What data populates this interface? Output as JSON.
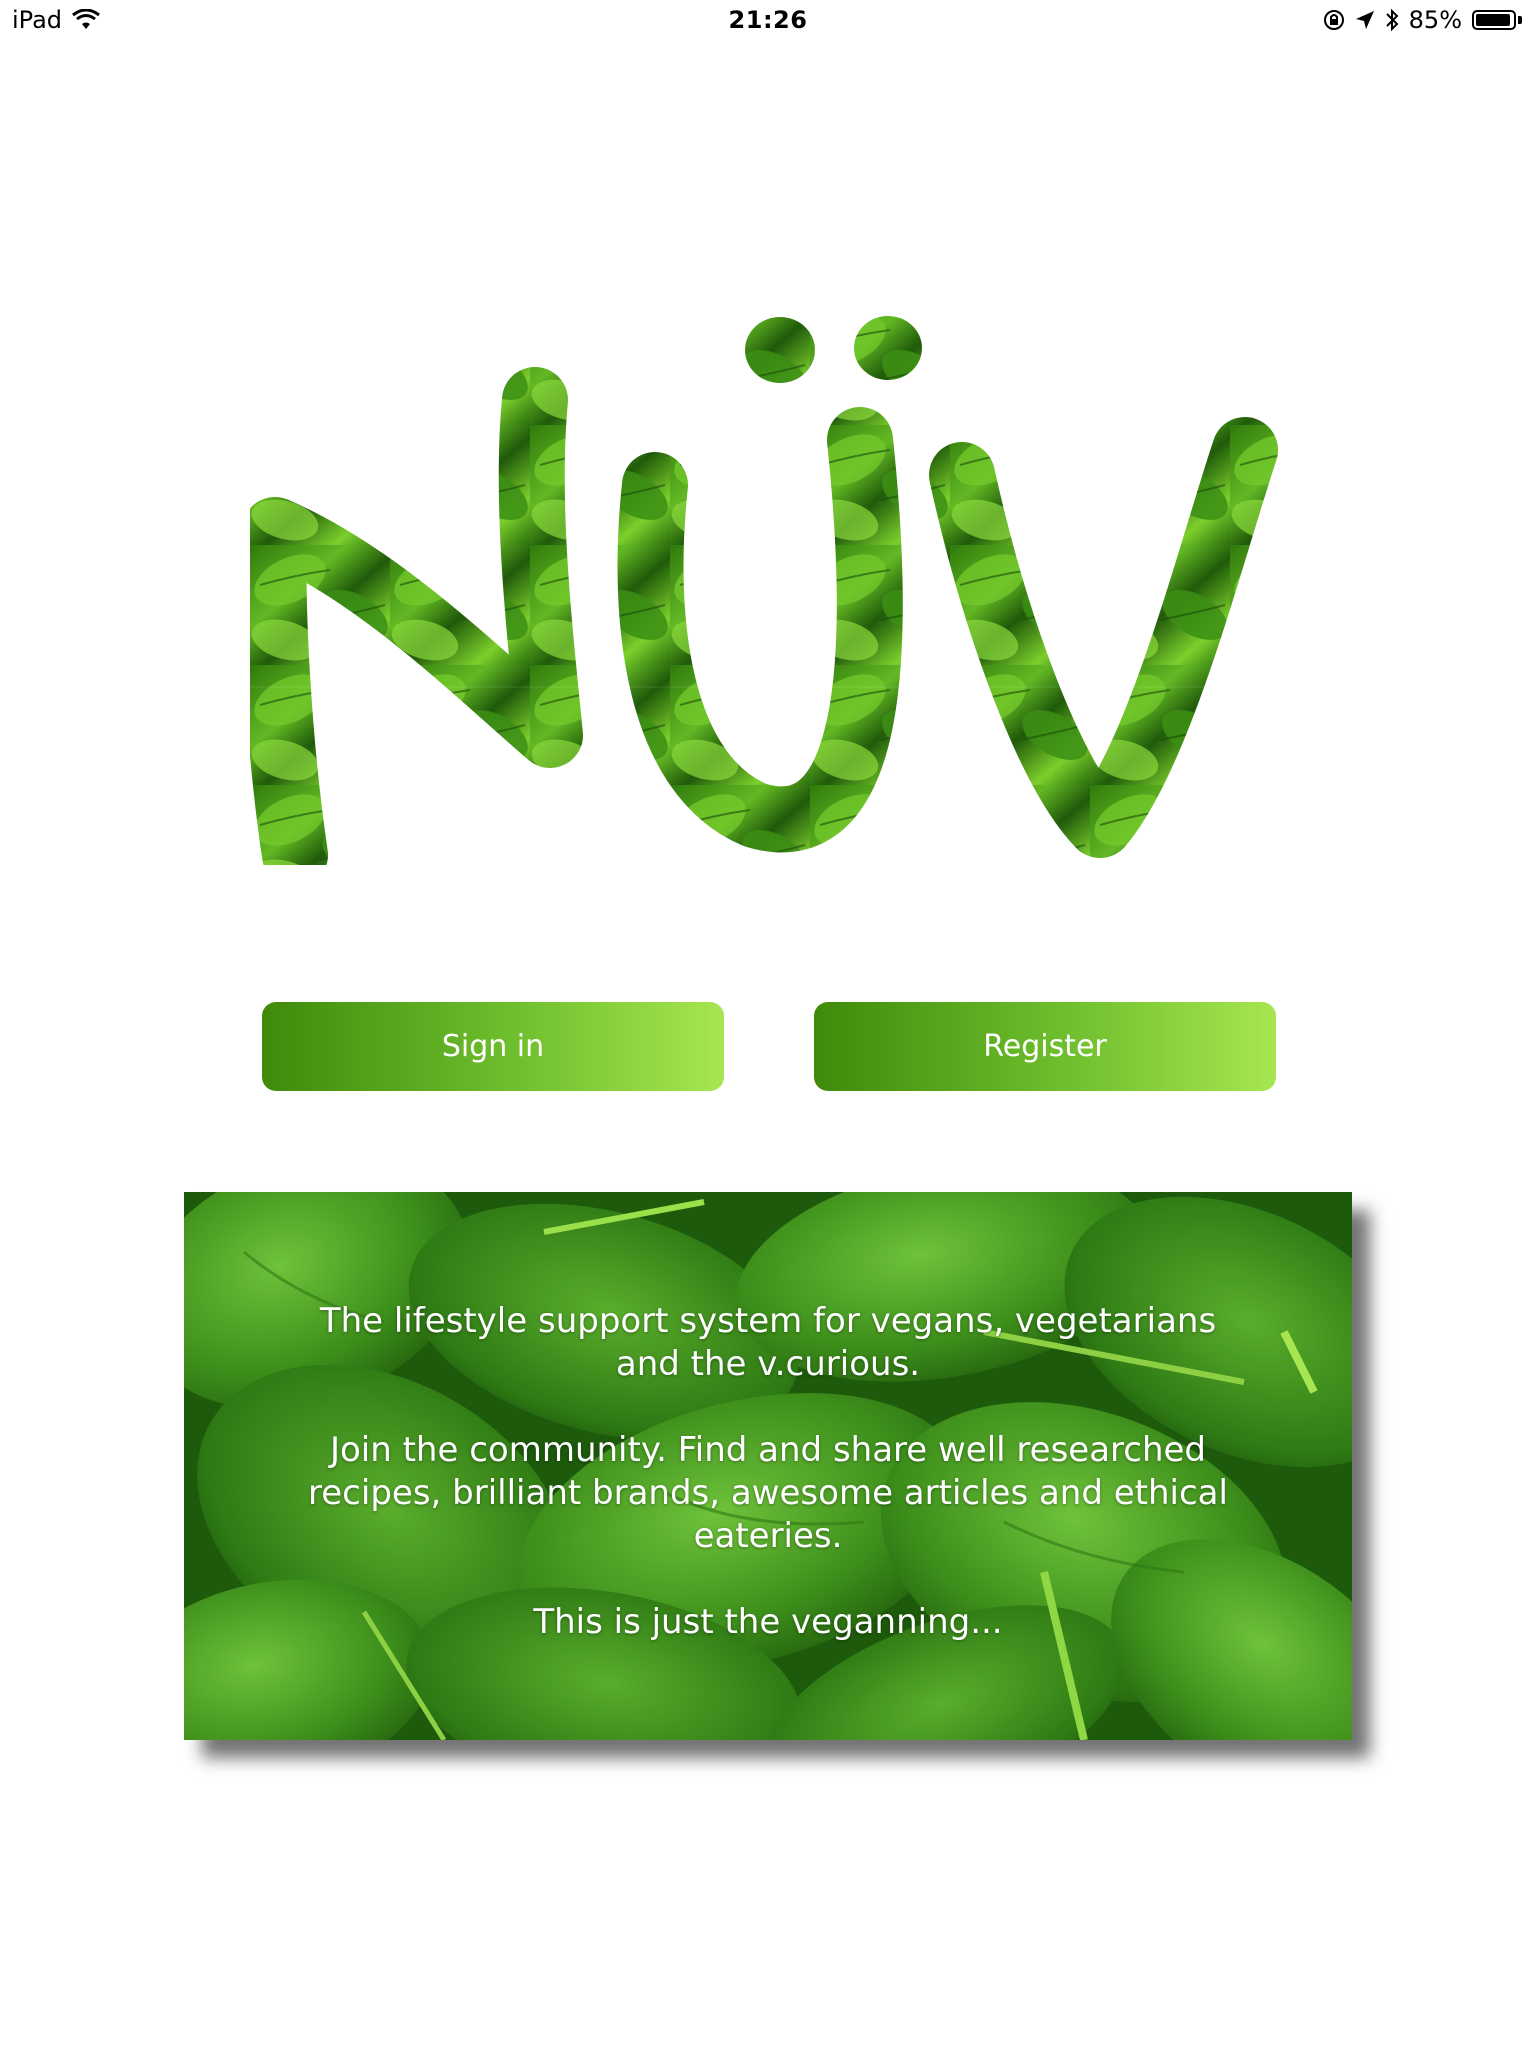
{
  "status_bar": {
    "device": "iPad",
    "time": "21:26",
    "battery_percent": "85%",
    "battery_level": 0.85
  },
  "logo": {
    "text": "NÜV",
    "colors": {
      "leaf_dark": "#1f5a0a",
      "leaf_mid": "#3a8f12",
      "leaf_light": "#7ccf2c"
    }
  },
  "buttons": {
    "sign_in": "Sign in",
    "register": "Register"
  },
  "info": {
    "line1": "The lifestyle support system for vegans, vegetarians and the v.curious.",
    "line2": "Join the community. Find and share well researched recipes, brilliant brands, awesome articles and ethical eateries.",
    "line3": "This is just the veganning..."
  },
  "theme": {
    "button_gradient_start": "#3f8a0a",
    "button_gradient_end": "#a7e650",
    "text_color": "#ffffff"
  }
}
